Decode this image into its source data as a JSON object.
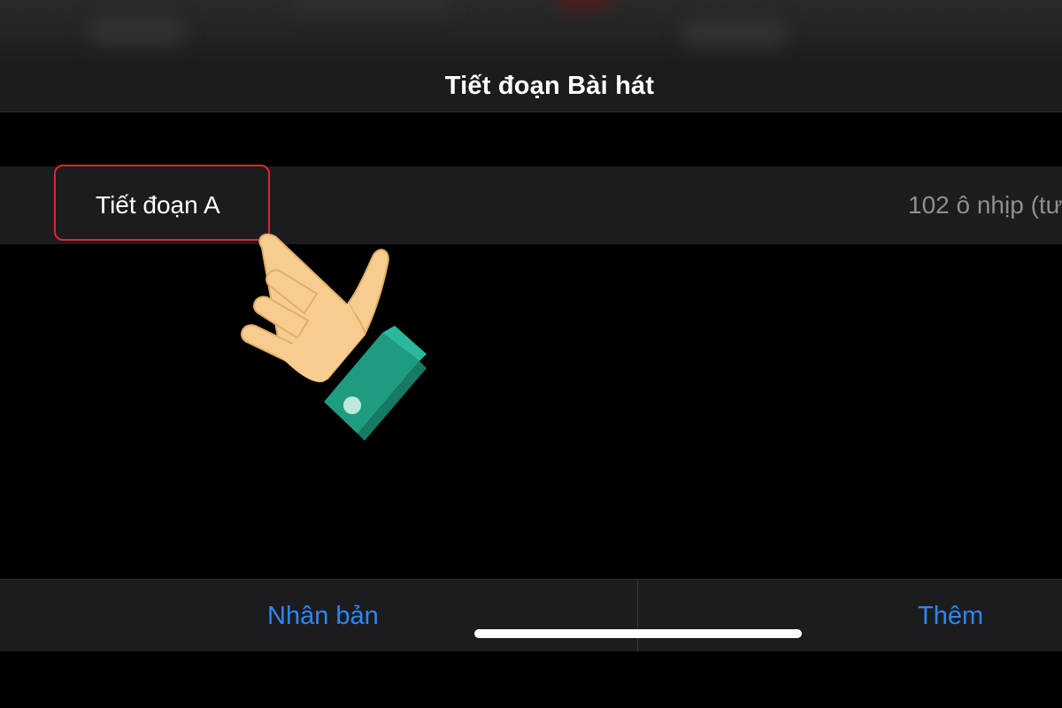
{
  "nav": {
    "title": "Tiết đoạn Bài hát"
  },
  "section_row": {
    "label": "Tiết đoạn A",
    "value": "102 ô nhịp (tư"
  },
  "toolbar": {
    "duplicate_label": "Nhân bản",
    "add_label": "Thêm"
  },
  "colors": {
    "accent": "#2f86f6",
    "highlight": "#e0262d",
    "background": "#000000",
    "surface": "#1c1c1e"
  },
  "icons": {
    "pointer": "pointing-hand-icon"
  }
}
